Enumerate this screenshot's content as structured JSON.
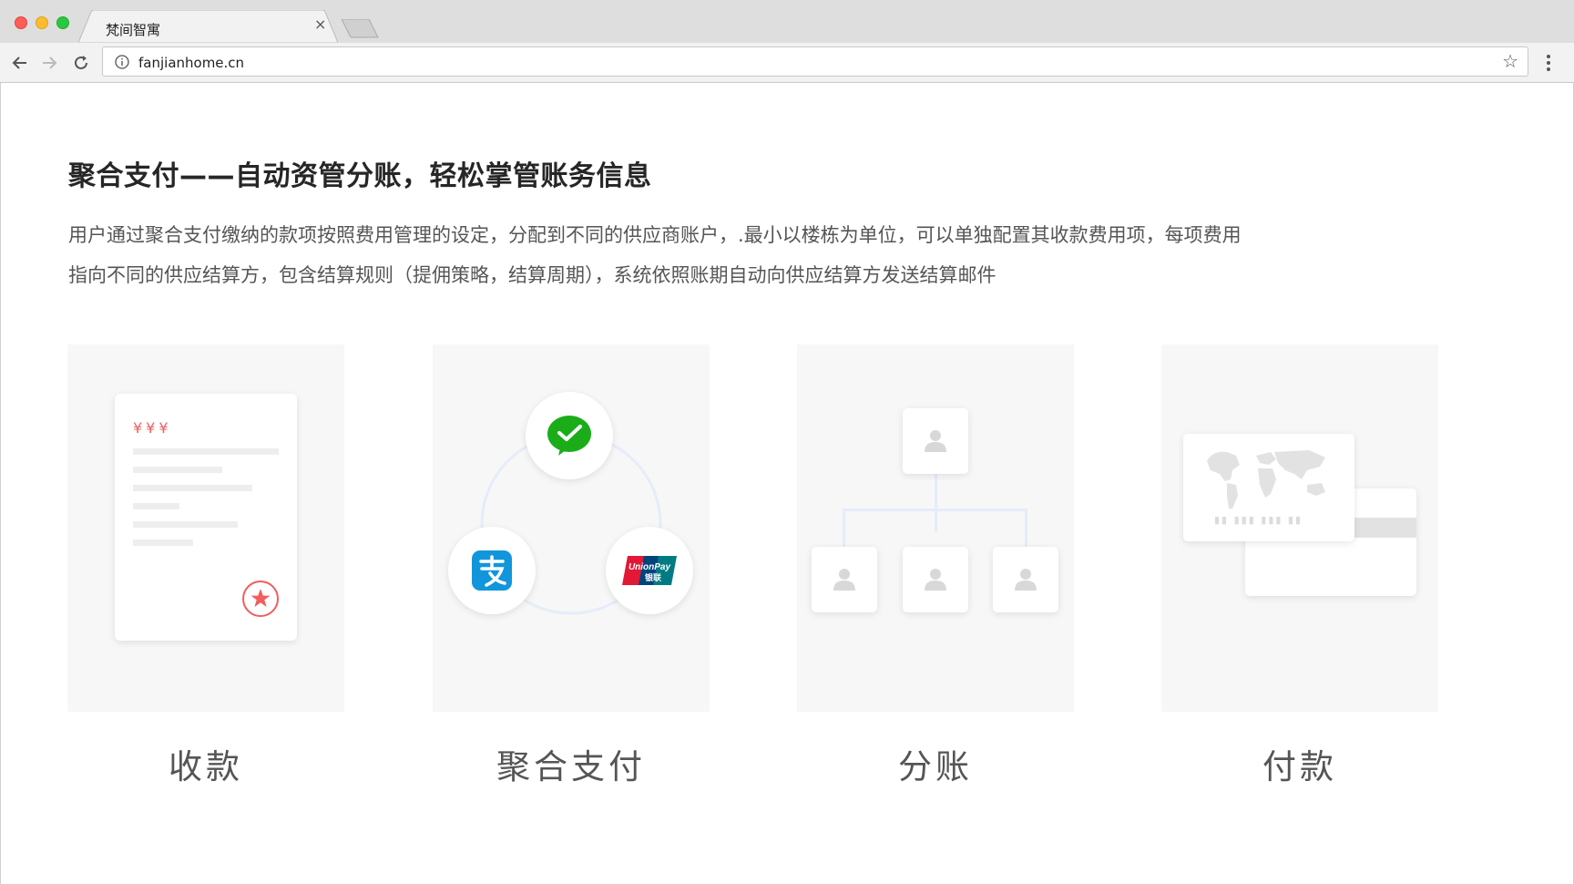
{
  "browser": {
    "tab_title": "梵间智寓",
    "tab_close": "×",
    "url": "fanjianhome.cn",
    "star": "☆"
  },
  "page": {
    "heading": "聚合支付——自动资管分账，轻松掌管账务信息",
    "description_lines": [
      "用户通过聚合支付缴纳的款项按照费用管理的设定，分配到不同的供应商账户，.最小以楼栋为单位，可以单独配置其收款费用项，每项费用",
      "指向不同的供应结算方，包含结算规则（提佣策略，结算周期），系统依照账期自动向供应结算方发送结算邮件"
    ]
  },
  "features": [
    {
      "label": "收款",
      "icon": "receipt-icon",
      "yen_marks": "¥¥¥"
    },
    {
      "label": "聚合支付",
      "icons": [
        "wechat-pay-icon",
        "alipay-icon",
        "unionpay-icon"
      ],
      "unionpay_text": "UnionPay",
      "unionpay_cn": "银联"
    },
    {
      "label": "分账",
      "icon": "org-tree-icon"
    },
    {
      "label": "付款",
      "icon": "bank-card-icon",
      "card_number_mask": "▮▮ ▮▮▮ ▮▮▮ ▮▮"
    }
  ],
  "colors": {
    "accent_red": "#f25d5d",
    "wechat_green": "#1aad19",
    "alipay_blue": "#1296db",
    "card_bg": "#f7f7f7"
  }
}
